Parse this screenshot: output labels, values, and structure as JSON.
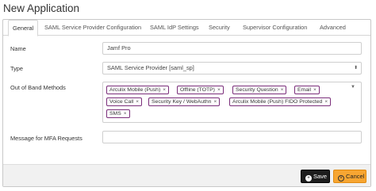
{
  "window": {
    "title": "New Application"
  },
  "tabs": [
    {
      "label": "General",
      "active": true
    },
    {
      "label": "SAML Service Provider Configuration",
      "active": false
    },
    {
      "label": "SAML IdP Settings",
      "active": false
    },
    {
      "label": "Security",
      "active": false
    },
    {
      "label": "Supervisor Configuration",
      "active": false
    },
    {
      "label": "Advanced",
      "active": false
    }
  ],
  "form": {
    "name": {
      "label": "Name",
      "value": "Jamf Pro"
    },
    "type": {
      "label": "Type",
      "value": "SAML Service Provider [saml_sp]"
    },
    "oob": {
      "label": "Out of Band Methods",
      "chips": [
        "Arculix Mobile (Push)",
        "Offline (TOTP)",
        "Security Question",
        "Email",
        "Voice Call",
        "Security Key / WebAuthn",
        "Arculix Mobile (Push) FIDO Protected",
        "SMS"
      ],
      "remove_glyph": "×"
    },
    "mfa_message": {
      "label": "Message for MFA Requests",
      "value": ""
    }
  },
  "footer": {
    "save_label": "Save",
    "cancel_label": "Cancel"
  },
  "colors": {
    "chip_border": "#7a2e7a",
    "save_bg": "#1d1d1d",
    "cancel_bg": "#f7a632"
  },
  "icons": {
    "save": "plus-circle-icon",
    "cancel": "x-circle-icon",
    "select": "updown-arrows-icon",
    "multi": "chevron-down-icon"
  }
}
